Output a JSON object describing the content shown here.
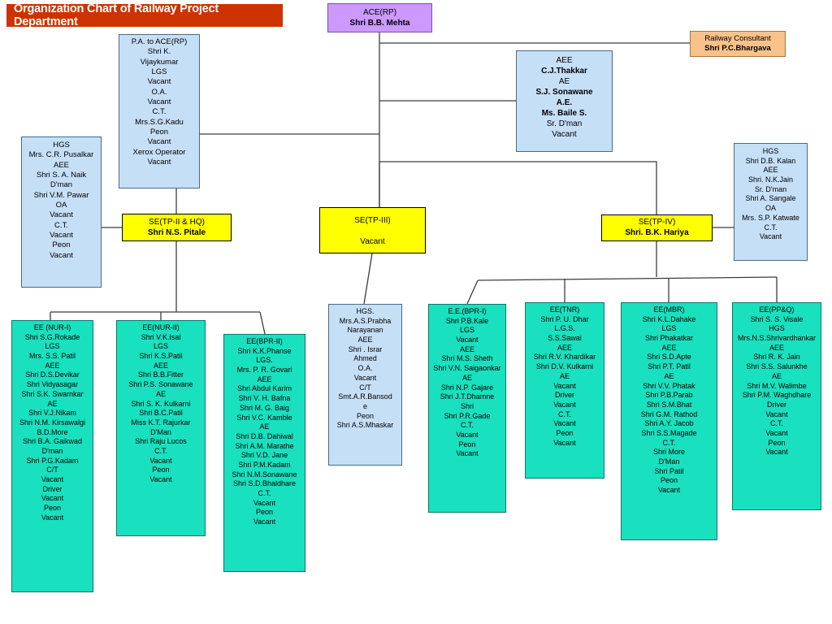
{
  "title": {
    "text": "Organization Chart of Railway Project Department",
    "bg": "#cc3300",
    "color": "#ffffff"
  },
  "colors": {
    "blue": "#c5dff7",
    "purple": "#cc99ff",
    "orange": "#f8c28a",
    "yellow": "#ffff00",
    "green": "#19e0be",
    "banner": "#cc3300",
    "line": "#3c3c3c"
  },
  "nodes": {
    "ace": {
      "id": "ace-rp",
      "color": "purple",
      "lines": [
        {
          "t": "ACE(RP)",
          "b": false
        },
        {
          "t": "Shri B.B. Mehta",
          "b": true
        }
      ]
    },
    "consultant": {
      "id": "railway-consultant",
      "color": "orange",
      "lines": [
        {
          "t": "Railway Consultant",
          "b": false
        },
        {
          "t": "Shri P.C.Bhargava",
          "b": true
        }
      ]
    },
    "pa": {
      "id": "pa-to-ace-rp",
      "color": "blue",
      "lines": [
        {
          "t": "P.A. to ACE(RP)",
          "b": false
        },
        {
          "t": "Shri K.",
          "b": false
        },
        {
          "t": "Vijaykumar",
          "b": false
        },
        {
          "t": "LGS",
          "b": false
        },
        {
          "t": "Vacant",
          "b": false
        },
        {
          "t": "O.A.",
          "b": false
        },
        {
          "t": "Vacant",
          "b": false
        },
        {
          "t": "C.T.",
          "b": false
        },
        {
          "t": "Mrs.S.G.Kadu",
          "b": false
        },
        {
          "t": "Peon",
          "b": false
        },
        {
          "t": "Vacant",
          "b": false
        },
        {
          "t": "Xerox Operator",
          "b": false
        },
        {
          "t": "Vacant",
          "b": false
        }
      ]
    },
    "aee_top": {
      "id": "aee-thakkar",
      "color": "blue",
      "lines": [
        {
          "t": "AEE",
          "b": false
        },
        {
          "t": "C.J.Thakkar",
          "b": true
        },
        {
          "t": "AE",
          "b": false
        },
        {
          "t": "S.J. Sonawane",
          "b": true
        },
        {
          "t": "A.E.",
          "b": true
        },
        {
          "t": "Ms. Baile S.",
          "b": true
        },
        {
          "t": "Sr. D'man",
          "b": false
        },
        {
          "t": "Vacant",
          "b": false
        }
      ]
    },
    "hgs_left": {
      "id": "hgs-pusalkar",
      "color": "blue",
      "lines": [
        {
          "t": "HGS",
          "b": false
        },
        {
          "t": "Mrs. C.R. Pusalkar",
          "b": false
        },
        {
          "t": "AEE",
          "b": false
        },
        {
          "t": "Shri S. A. Naik",
          "b": false
        },
        {
          "t": "D'man",
          "b": false
        },
        {
          "t": "Shri V.M. Pawar",
          "b": false
        },
        {
          "t": "OA",
          "b": false
        },
        {
          "t": "Vacant",
          "b": false
        },
        {
          "t": "C.T.",
          "b": false
        },
        {
          "t": "Vacant",
          "b": false
        },
        {
          "t": "Peon",
          "b": false
        },
        {
          "t": "Vacant",
          "b": false
        }
      ]
    },
    "hgs_right": {
      "id": "hgs-kalan",
      "color": "blue",
      "lines": [
        {
          "t": "HGS",
          "b": false
        },
        {
          "t": "Shri D.B. Kalan",
          "b": false
        },
        {
          "t": "AEE",
          "b": false
        },
        {
          "t": "Shri. N.K.Jain",
          "b": false
        },
        {
          "t": "Sr. D'man",
          "b": false
        },
        {
          "t": "Shri A. Sangale",
          "b": false
        },
        {
          "t": "OA",
          "b": false
        },
        {
          "t": "Mrs. S.P. Katwate",
          "b": false
        },
        {
          "t": "C.T.",
          "b": false
        },
        {
          "t": "Vacant",
          "b": false
        }
      ]
    },
    "se2": {
      "id": "se-tp2-hq",
      "color": "yellow",
      "lines": [
        {
          "t": "SE(TP-II & HQ)",
          "b": false
        },
        {
          "t": "Shri N.S. Pitale",
          "b": true
        }
      ]
    },
    "se3": {
      "id": "se-tp3",
      "color": "yellow",
      "lines": [
        {
          "t": "SE(TP-III)",
          "b": false
        },
        {
          "t": "",
          "b": false
        },
        {
          "t": "Vacant",
          "b": false
        }
      ]
    },
    "se4": {
      "id": "se-tp4",
      "color": "yellow",
      "lines": [
        {
          "t": "SE(TP-IV)",
          "b": false
        },
        {
          "t": "Shri. B.K. Hariya",
          "b": true
        }
      ]
    },
    "nur1": {
      "id": "ee-nur-1",
      "color": "green",
      "lines": [
        {
          "t": "EE (NUR-I)",
          "b": false
        },
        {
          "t": "Shri S.G.Rokade",
          "b": false
        },
        {
          "t": "LGS",
          "b": false
        },
        {
          "t": "Mrs. S.S. Patil",
          "b": false
        },
        {
          "t": "AEE",
          "b": false
        },
        {
          "t": "Shri D.S.Devikar",
          "b": false
        },
        {
          "t": "Shri Vidyasagar",
          "b": false
        },
        {
          "t": "Shri S.K. Swarnkar",
          "b": false
        },
        {
          "t": "AE",
          "b": false
        },
        {
          "t": "Shri V.J.Nikam",
          "b": false
        },
        {
          "t": "Shri N.M. Kirsawalgi",
          "b": false
        },
        {
          "t": "B.D.More",
          "b": false
        },
        {
          "t": "Shri B.A. Gaikwad",
          "b": false
        },
        {
          "t": "D'man",
          "b": false
        },
        {
          "t": "Shri P.G.Kadam",
          "b": false
        },
        {
          "t": "C/T",
          "b": false
        },
        {
          "t": "Vacant",
          "b": false
        },
        {
          "t": "Driver",
          "b": false
        },
        {
          "t": "Vacant",
          "b": false
        },
        {
          "t": "Peon",
          "b": false
        },
        {
          "t": "Vacant",
          "b": false
        }
      ]
    },
    "nur2": {
      "id": "ee-nur-2",
      "color": "green",
      "lines": [
        {
          "t": "EE(NUR-II)",
          "b": false
        },
        {
          "t": "Shri V.K.Isal",
          "b": false
        },
        {
          "t": "LGS",
          "b": false
        },
        {
          "t": "Shri K.S.Patil",
          "b": false
        },
        {
          "t": "AEE",
          "b": false
        },
        {
          "t": "Shri B.B.Fitter",
          "b": false
        },
        {
          "t": "Shri P.S. Sonawane",
          "b": false
        },
        {
          "t": "AE",
          "b": false
        },
        {
          "t": "Shri S. K. Kulkarni",
          "b": false
        },
        {
          "t": "Shri B.C.Patil",
          "b": false
        },
        {
          "t": "Miss K.T. Rajurkar",
          "b": false
        },
        {
          "t": "D'Man",
          "b": false
        },
        {
          "t": "Shri Raju Lucos",
          "b": false
        },
        {
          "t": "C.T.",
          "b": false
        },
        {
          "t": "Vacant",
          "b": false
        },
        {
          "t": "Peon",
          "b": false
        },
        {
          "t": "Vacant",
          "b": false
        }
      ]
    },
    "bpr2": {
      "id": "ee-bpr-2",
      "color": "green",
      "lines": [
        {
          "t": "EE(BPR-II)",
          "b": false
        },
        {
          "t": "Shri K.K.Phanse",
          "b": false
        },
        {
          "t": "LGS.",
          "b": false
        },
        {
          "t": "Mrs. P. R. Govari",
          "b": false
        },
        {
          "t": "AEE",
          "b": false
        },
        {
          "t": "Shri Abdul Karim",
          "b": false
        },
        {
          "t": "Shri V. H. Bafna",
          "b": false
        },
        {
          "t": "Shri M. G. Baig",
          "b": false
        },
        {
          "t": "Shri V.C. Kamble",
          "b": false
        },
        {
          "t": "AE",
          "b": false
        },
        {
          "t": "Shri D.B. Dahiwal",
          "b": false
        },
        {
          "t": "Shri A.M. Marathe",
          "b": false
        },
        {
          "t": "Shri  V.D. Jane",
          "b": false
        },
        {
          "t": "Shri P.M.Kadam",
          "b": false
        },
        {
          "t": "Shri N.M.Sonawane",
          "b": false
        },
        {
          "t": "Shri S.D.Bhaldhare",
          "b": false
        },
        {
          "t": "C.T.",
          "b": false
        },
        {
          "t": "Vacant",
          "b": false
        },
        {
          "t": "Peon",
          "b": false
        },
        {
          "t": "Vacant",
          "b": false
        }
      ]
    },
    "hgs_mid": {
      "id": "hgs-prabha-narayanan",
      "color": "blue",
      "lines": [
        {
          "t": "HGS.",
          "b": false
        },
        {
          "t": "Mrs.A.S.Prabha",
          "b": false
        },
        {
          "t": "Narayanan",
          "b": false
        },
        {
          "t": "AEE",
          "b": false
        },
        {
          "t": "Shri . Israr",
          "b": false
        },
        {
          "t": "Ahmed",
          "b": false
        },
        {
          "t": "O.A.",
          "b": false
        },
        {
          "t": "Vacant",
          "b": false
        },
        {
          "t": "C/T",
          "b": false
        },
        {
          "t": "Smt.A.R.Bansod",
          "b": false
        },
        {
          "t": "e",
          "b": false
        },
        {
          "t": "Peon",
          "b": false
        },
        {
          "t": "Shri A.S.Mhaskar",
          "b": false
        }
      ]
    },
    "bpr1": {
      "id": "ee-bpr-1",
      "color": "green",
      "lines": [
        {
          "t": "E.E.(BPR-I)",
          "b": false
        },
        {
          "t": "Shri P.B.Kale",
          "b": false
        },
        {
          "t": "LGS",
          "b": false
        },
        {
          "t": "Vacant",
          "b": false
        },
        {
          "t": "AEE",
          "b": false
        },
        {
          "t": "Shri M.S. Sheth",
          "b": false
        },
        {
          "t": "Shri V.N. Saigaonkar",
          "b": false
        },
        {
          "t": "AE",
          "b": false
        },
        {
          "t": "Shri   N.P. Gajare",
          "b": false
        },
        {
          "t": "Shri J.T.Dhamne",
          "b": false
        },
        {
          "t": "Shri",
          "b": false
        },
        {
          "t": "Shri P.R.Gade",
          "b": false
        },
        {
          "t": "C.T.",
          "b": false
        },
        {
          "t": "Vacant",
          "b": false
        },
        {
          "t": "Peon",
          "b": false
        },
        {
          "t": "Vacant",
          "b": false
        }
      ]
    },
    "tnr": {
      "id": "ee-tnr",
      "color": "green",
      "lines": [
        {
          "t": "EE(TNR)",
          "b": false
        },
        {
          "t": "Shri P. U. Dhar",
          "b": false
        },
        {
          "t": "L.G.S.",
          "b": false
        },
        {
          "t": "S.S.Sawai",
          "b": false
        },
        {
          "t": "AEE",
          "b": false
        },
        {
          "t": "Shri R.V. Khardikar",
          "b": false
        },
        {
          "t": "Shri D.V. Kulkarni",
          "b": false
        },
        {
          "t": "AE",
          "b": false
        },
        {
          "t": "Vacant",
          "b": false
        },
        {
          "t": "Driver",
          "b": false
        },
        {
          "t": "Vacant",
          "b": false
        },
        {
          "t": "C.T.",
          "b": false
        },
        {
          "t": "Vacant",
          "b": false
        },
        {
          "t": "Peon",
          "b": false
        },
        {
          "t": "Vacant",
          "b": false
        }
      ]
    },
    "mbr": {
      "id": "ee-mbr",
      "color": "green",
      "lines": [
        {
          "t": "EE(MBR)",
          "b": false
        },
        {
          "t": "Shri K.L.Dahake",
          "b": false
        },
        {
          "t": "LGS",
          "b": false
        },
        {
          "t": "Shri Phakatkar",
          "b": false
        },
        {
          "t": "AEE",
          "b": false
        },
        {
          "t": "Shri S.D.Apte",
          "b": false
        },
        {
          "t": "Shri P.T. Patil",
          "b": false
        },
        {
          "t": "AE",
          "b": false
        },
        {
          "t": "Shri V.V. Phatak",
          "b": false
        },
        {
          "t": "Shri P.B.Parab",
          "b": false
        },
        {
          "t": "Shri S.M.Bhat",
          "b": false
        },
        {
          "t": "Shri G.M. Rathod",
          "b": false
        },
        {
          "t": "Shri A.Y. Jacob",
          "b": false
        },
        {
          "t": "Shri S.S.Magade",
          "b": false
        },
        {
          "t": "C.T.",
          "b": false
        },
        {
          "t": "Shri More",
          "b": false
        },
        {
          "t": "D'Man",
          "b": false
        },
        {
          "t": "Shri Patil",
          "b": false
        },
        {
          "t": "Peon",
          "b": false
        },
        {
          "t": "Vacant",
          "b": false
        }
      ]
    },
    "ppq": {
      "id": "ee-pp-and-q",
      "color": "green",
      "lines": [
        {
          "t": "EE(PP&Q)",
          "b": false
        },
        {
          "t": "Shri S. S. Visale",
          "b": false
        },
        {
          "t": "HGS",
          "b": false
        },
        {
          "t": "Mrs.N.S.Shrivardhankar",
          "b": false
        },
        {
          "t": "AEE",
          "b": false
        },
        {
          "t": "Shri R. K. Jain",
          "b": false
        },
        {
          "t": "Shri S.S. Salunkhe",
          "b": false
        },
        {
          "t": "AE",
          "b": false
        },
        {
          "t": "Shri M.V. Walimbe",
          "b": false
        },
        {
          "t": "Shri P.M. Waghdhare",
          "b": false
        },
        {
          "t": "Driver",
          "b": false
        },
        {
          "t": "Vacant",
          "b": false
        },
        {
          "t": "C.T.",
          "b": false
        },
        {
          "t": "Vacant",
          "b": false
        },
        {
          "t": "Peon",
          "b": false
        },
        {
          "t": "Vacant",
          "b": false
        }
      ]
    }
  }
}
